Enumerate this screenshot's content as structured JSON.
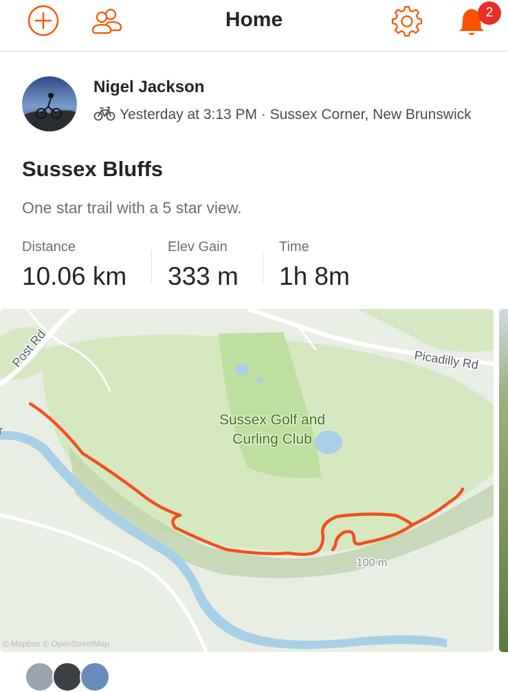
{
  "header": {
    "title": "Home",
    "notification_count": "2"
  },
  "post": {
    "athlete_name": "Nigel Jackson",
    "activity_icon": "bike-icon",
    "meta": "Yesterday at 3:13 PM · Sussex Corner, New Brunswick",
    "title": "Sussex Bluffs",
    "description": "One star trail with a 5 star view.",
    "stats": [
      {
        "label": "Distance",
        "value": "10.06 km"
      },
      {
        "label": "Elev Gain",
        "value": "333 m"
      },
      {
        "label": "Time",
        "value": "1h 8m"
      }
    ]
  },
  "map": {
    "labels": {
      "road_post": "Post Rd",
      "road_picadilly": "Picadilly Rd",
      "golf_line1": "Sussex Golf and",
      "golf_line2": "Curling Club",
      "scale": "100 m",
      "attribution": "© Mapbox © OpenStreetMap",
      "edge_letter": "r"
    },
    "colors": {
      "route": "#f0501e",
      "water": "#a8cfe8",
      "park": "#cfe5b0",
      "golf": "#bddfa0",
      "golf_label": "#3d7a1e"
    }
  },
  "colors": {
    "brand": "#fc5200",
    "badge": "#e8302a"
  }
}
